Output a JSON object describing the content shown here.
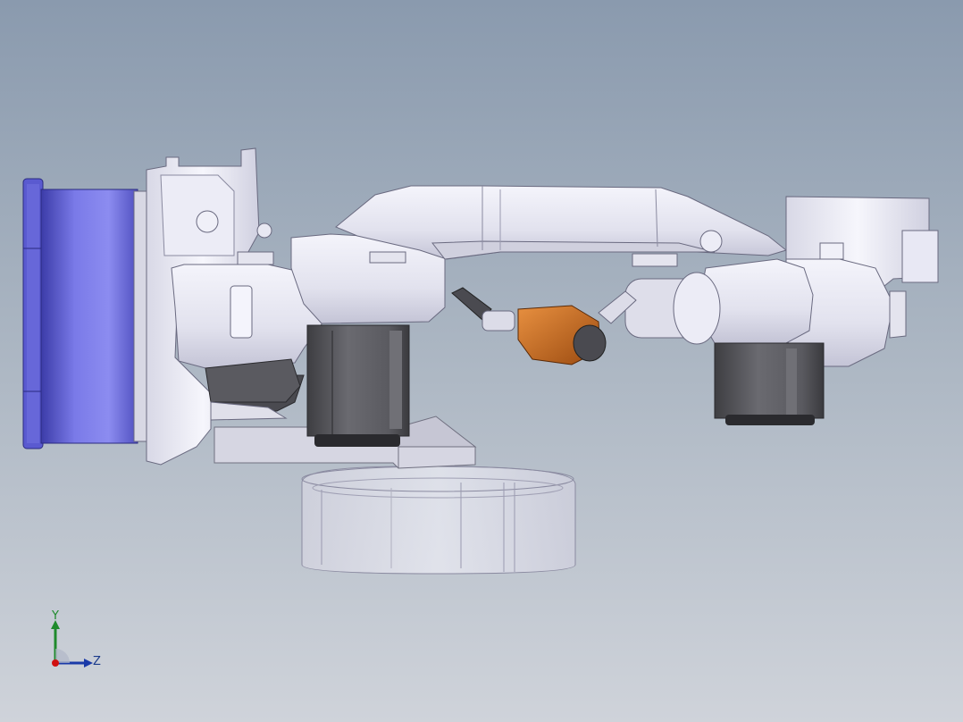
{
  "viewport": {
    "background_top": "#8a9aae",
    "background_bottom": "#cfd3da"
  },
  "model": {
    "description_colors": {
      "body": "#e6e6f2",
      "flange": "#6464d8",
      "motor": "#5a5a5e",
      "torch_tip": "#c8661e",
      "base_transparent": "#dcdce8"
    }
  },
  "triad": {
    "x_label": "X",
    "y_label": "Y",
    "z_label": "Z",
    "x_color": "#d01010",
    "y_color": "#1f8a2c",
    "z_color": "#1a3aa8"
  }
}
